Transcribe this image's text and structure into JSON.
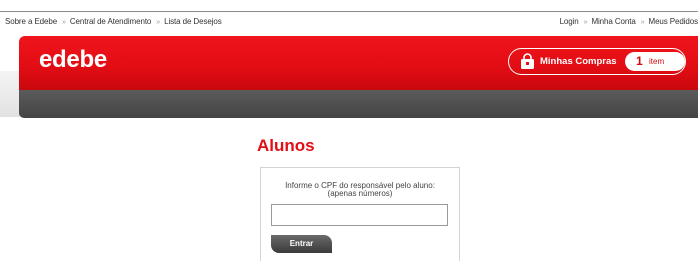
{
  "top_nav": {
    "left_links": [
      "Sobre a Edebe",
      "Central de Atendimento",
      "Lista de Desejos"
    ],
    "right_links": [
      "Login",
      "Minha Conta",
      "Meus Pedidos"
    ],
    "separator": "»"
  },
  "header": {
    "logo": "edebe",
    "cart": {
      "icon": "shopping-bag-icon",
      "label": "Minhas Compras",
      "count": "1",
      "count_unit": "item"
    }
  },
  "main": {
    "title": "Alunos",
    "instruction_line1": "Informe o CPF do responsável pelo aluno:",
    "instruction_line2": "(apenas números)",
    "cpf_input_value": "",
    "cpf_input_placeholder": "",
    "submit_label": "Entrar"
  },
  "colors": {
    "brand_red": "#e30d14",
    "nav_gray": "#4f4f4f"
  }
}
